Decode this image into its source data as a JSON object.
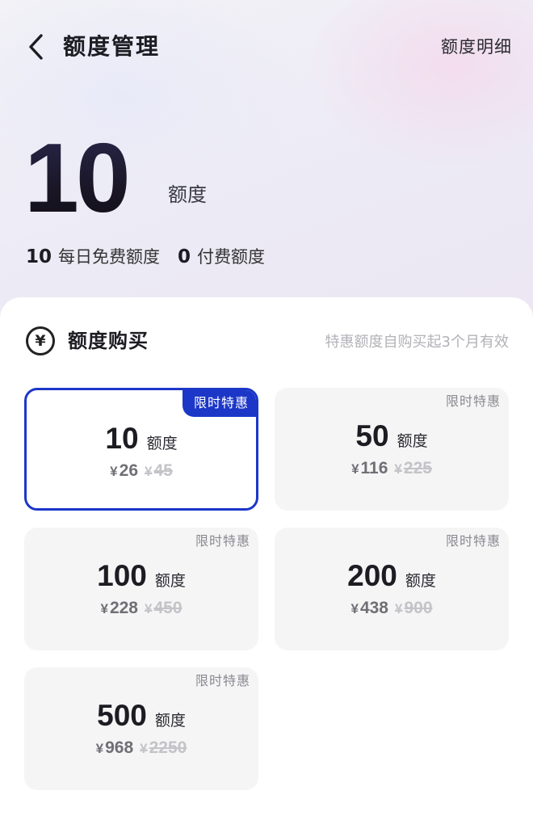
{
  "header": {
    "title": "额度管理",
    "detail_link": "额度明细"
  },
  "balance": {
    "total": "10",
    "unit": "额度",
    "daily_free_value": "10",
    "daily_free_label": "每日免费额度",
    "paid_value": "0",
    "paid_label": "付费额度"
  },
  "purchase": {
    "title": "额度购买",
    "currency_symbol": "¥",
    "note": "特惠额度自购买起3个月有效",
    "cards": [
      {
        "badge": "限时特惠",
        "amount": "10",
        "unit": "额度",
        "yen": "¥",
        "price": "26",
        "orig_yen": "¥",
        "original": "45",
        "selected": true
      },
      {
        "badge": "限时特惠",
        "amount": "50",
        "unit": "额度",
        "yen": "¥",
        "price": "116",
        "orig_yen": "¥",
        "original": "225",
        "selected": false
      },
      {
        "badge": "限时特惠",
        "amount": "100",
        "unit": "额度",
        "yen": "¥",
        "price": "228",
        "orig_yen": "¥",
        "original": "450",
        "selected": false
      },
      {
        "badge": "限时特惠",
        "amount": "200",
        "unit": "额度",
        "yen": "¥",
        "price": "438",
        "orig_yen": "¥",
        "original": "900",
        "selected": false
      },
      {
        "badge": "限时特惠",
        "amount": "500",
        "unit": "额度",
        "yen": "¥",
        "price": "968",
        "orig_yen": "¥",
        "original": "2250",
        "selected": false
      }
    ]
  },
  "colors": {
    "accent": "#1c37c8",
    "card_bg": "#f5f5f6"
  },
  "icons": {
    "back": "chevron-left-icon",
    "currency": "yen-circle-icon"
  }
}
